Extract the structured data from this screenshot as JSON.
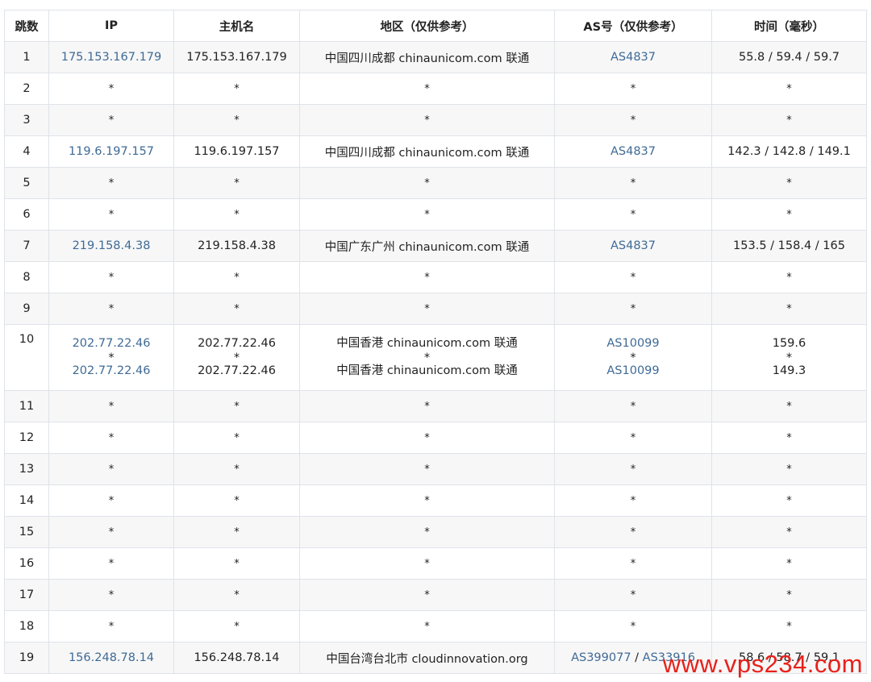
{
  "headers": [
    "跳数",
    "IP",
    "主机名",
    "地区（仅供参考）",
    "AS号（仅供参考）",
    "时间（毫秒）"
  ],
  "rows": [
    {
      "hop": "1",
      "ip": "175.153.167.179",
      "host": "175.153.167.179",
      "region": "中国四川成都 chinaunicom.com 联通",
      "as": "AS4837",
      "time": "55.8 / 59.4 / 59.7"
    },
    {
      "hop": "2",
      "ip": "*",
      "host": "*",
      "region": "*",
      "as": "*",
      "time": "*"
    },
    {
      "hop": "3",
      "ip": "*",
      "host": "*",
      "region": "*",
      "as": "*",
      "time": "*"
    },
    {
      "hop": "4",
      "ip": "119.6.197.157",
      "host": "119.6.197.157",
      "region": "中国四川成都 chinaunicom.com 联通",
      "as": "AS4837",
      "time": "142.3 / 142.8 / 149.1"
    },
    {
      "hop": "5",
      "ip": "*",
      "host": "*",
      "region": "*",
      "as": "*",
      "time": "*"
    },
    {
      "hop": "6",
      "ip": "*",
      "host": "*",
      "region": "*",
      "as": "*",
      "time": "*"
    },
    {
      "hop": "7",
      "ip": "219.158.4.38",
      "host": "219.158.4.38",
      "region": "中国广东广州 chinaunicom.com 联通",
      "as": "AS4837",
      "time": "153.5 / 158.4 / 165"
    },
    {
      "hop": "8",
      "ip": "*",
      "host": "*",
      "region": "*",
      "as": "*",
      "time": "*"
    },
    {
      "hop": "9",
      "ip": "*",
      "host": "*",
      "region": "*",
      "as": "*",
      "time": "*"
    },
    {
      "hop": "10",
      "ip": "202.77.22.46",
      "host": "202.77.22.46",
      "region": "中国香港 chinaunicom.com 联通",
      "as": "AS10099",
      "time": "159.6",
      "ip_mid": "*",
      "host_mid": "*",
      "region_mid": "*",
      "as_mid": "*",
      "time_mid": "*",
      "ip2": "202.77.22.46",
      "host2": "202.77.22.46",
      "region2": "中国香港 chinaunicom.com 联通",
      "as2": "AS10099",
      "time2": "149.3"
    },
    {
      "hop": "11",
      "ip": "*",
      "host": "*",
      "region": "*",
      "as": "*",
      "time": "*"
    },
    {
      "hop": "12",
      "ip": "*",
      "host": "*",
      "region": "*",
      "as": "*",
      "time": "*"
    },
    {
      "hop": "13",
      "ip": "*",
      "host": "*",
      "region": "*",
      "as": "*",
      "time": "*"
    },
    {
      "hop": "14",
      "ip": "*",
      "host": "*",
      "region": "*",
      "as": "*",
      "time": "*"
    },
    {
      "hop": "15",
      "ip": "*",
      "host": "*",
      "region": "*",
      "as": "*",
      "time": "*"
    },
    {
      "hop": "16",
      "ip": "*",
      "host": "*",
      "region": "*",
      "as": "*",
      "time": "*"
    },
    {
      "hop": "17",
      "ip": "*",
      "host": "*",
      "region": "*",
      "as": "*",
      "time": "*"
    },
    {
      "hop": "18",
      "ip": "*",
      "host": "*",
      "region": "*",
      "as": "*",
      "time": "*"
    },
    {
      "hop": "19",
      "ip": "156.248.78.14",
      "host": "156.248.78.14",
      "region": "中国台湾台北市 cloudinnovation.org",
      "as": "AS399077",
      "as_sep": " / ",
      "as_b": "AS33916",
      "time": "58.6 / 58.7 / 59.1"
    }
  ],
  "watermark": "www.vps234.com",
  "colors": {
    "link": "#3f6a96",
    "watermark": "#e8211a",
    "border": "#dfe3e8",
    "stripe": "#f7f7f7"
  }
}
